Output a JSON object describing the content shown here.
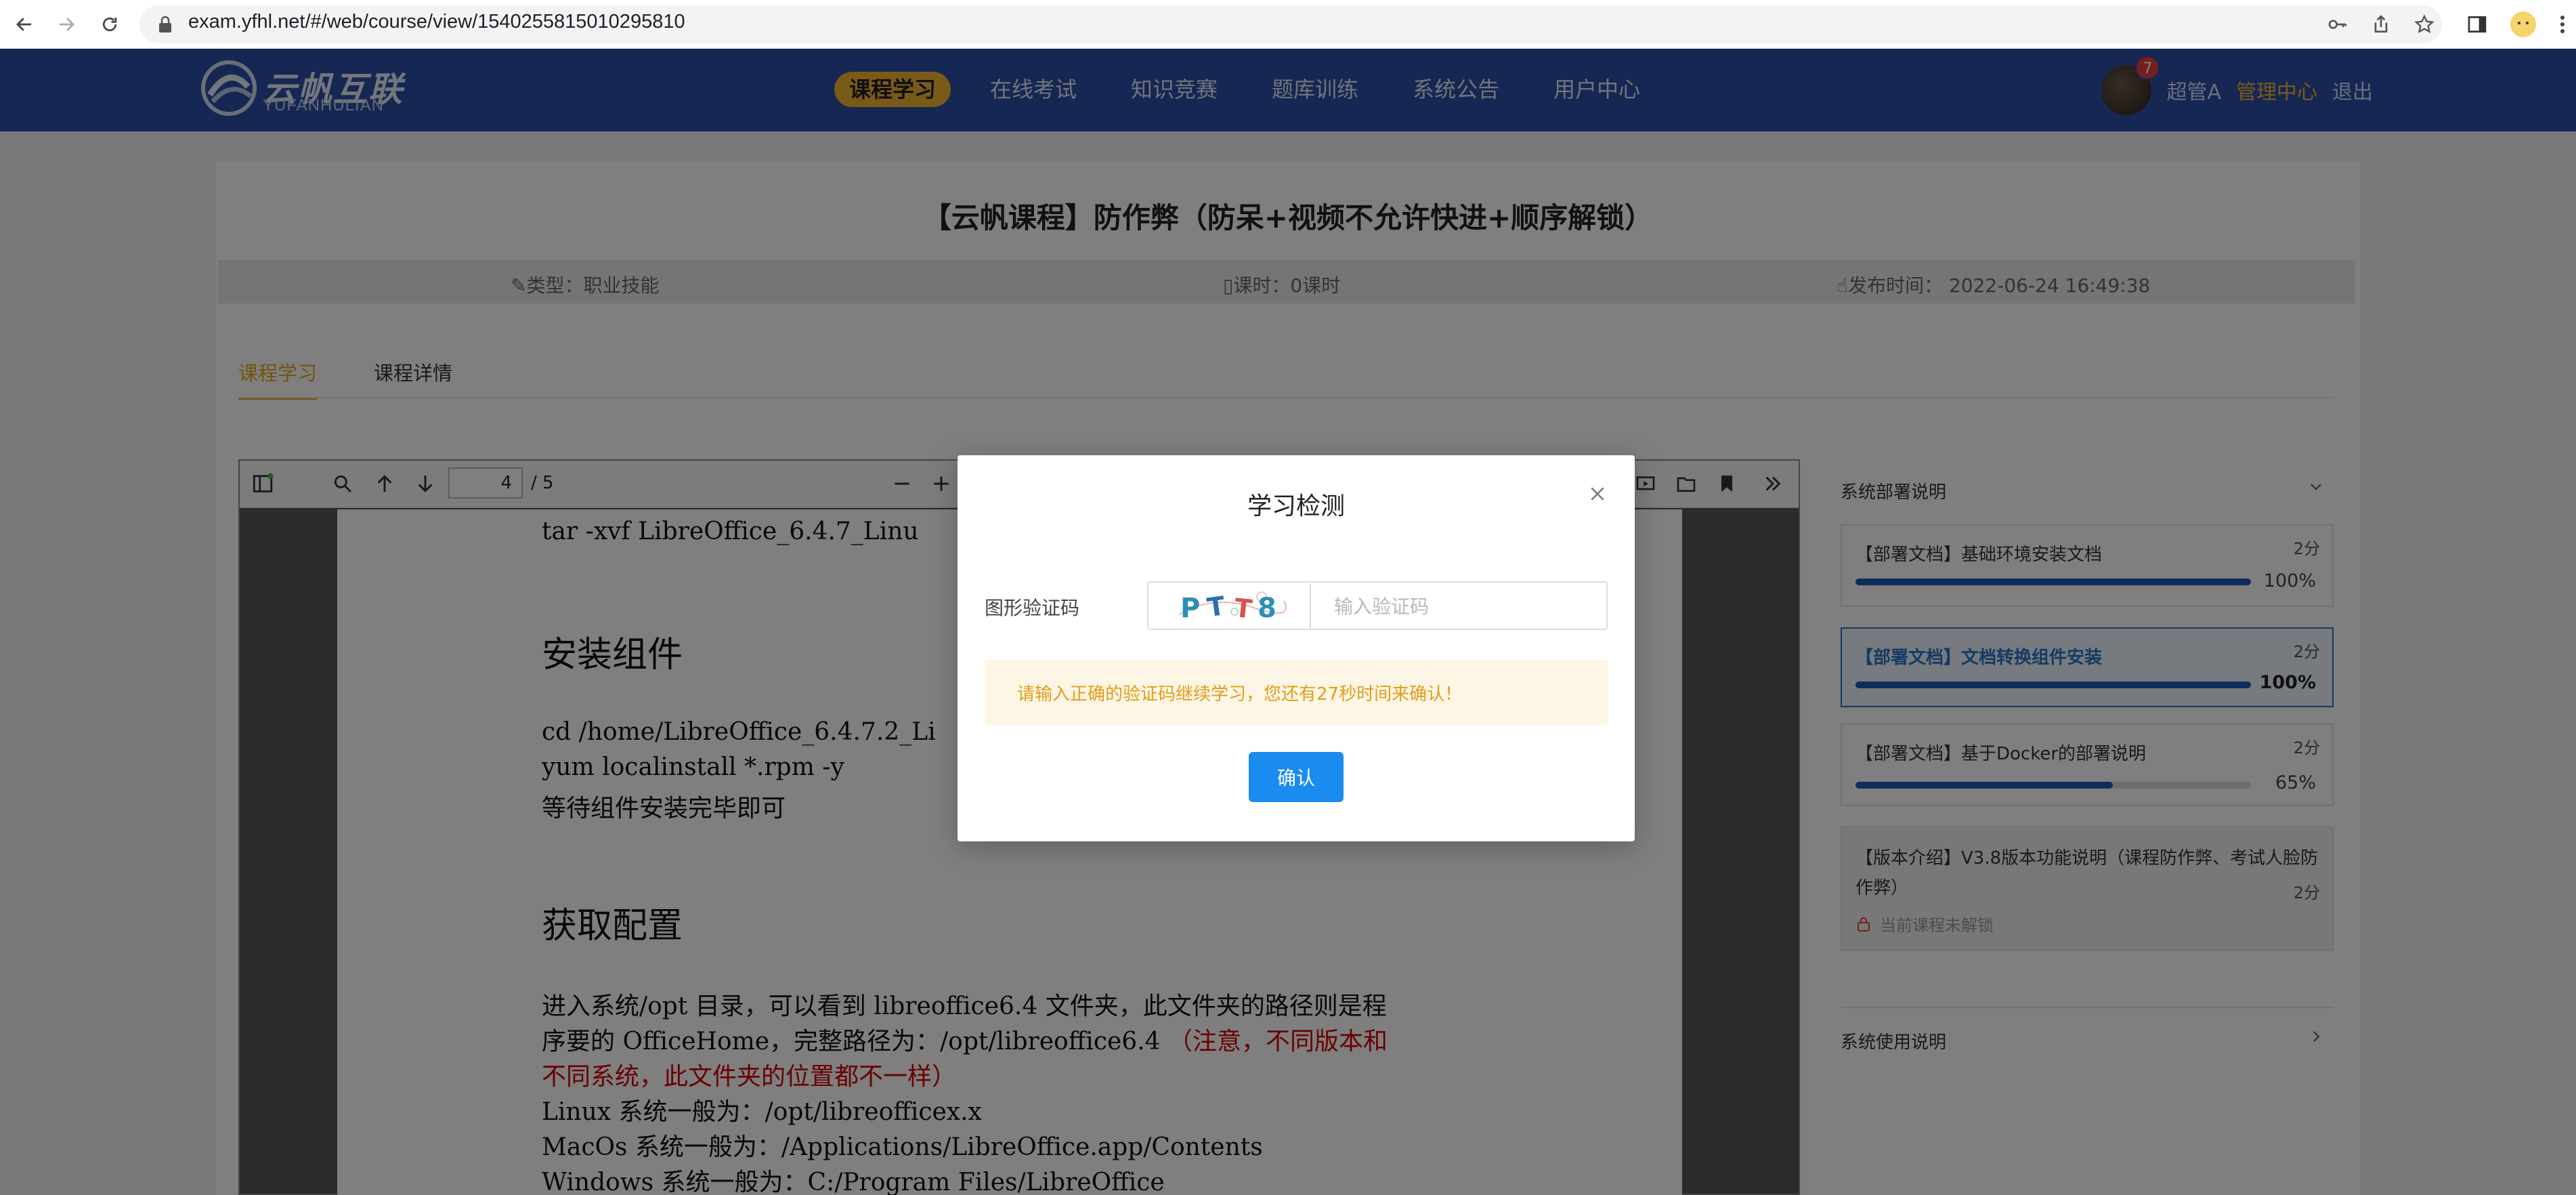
{
  "browser": {
    "url": "exam.yfhl.net/#/web/course/view/1540255815010295810"
  },
  "header": {
    "logo_cn": "云帆互联",
    "logo_en": "YUFANHULIAN",
    "nav": [
      {
        "label": "课程学习",
        "active": true
      },
      {
        "label": "在线考试"
      },
      {
        "label": "知识竞赛"
      },
      {
        "label": "题库训练"
      },
      {
        "label": "系统公告"
      },
      {
        "label": "用户中心"
      }
    ],
    "badge_count": "7",
    "user_name": "超管A",
    "admin_link": "管理中心",
    "logout_link": "退出"
  },
  "course": {
    "title": "【云帆课程】防作弊（防呆+视频不允许快进+顺序解锁）",
    "type": "类型：职业技能",
    "hours": "课时：0课时",
    "publish_time": "发布时间：  2022-06-24 16:49:38"
  },
  "tabs": [
    {
      "label": "课程学习",
      "active": true
    },
    {
      "label": "课程详情"
    }
  ],
  "viewer": {
    "page_current": "4",
    "page_total": "/ 5"
  },
  "pdf": {
    "line_tar": "tar -xvf LibreOffice_6.4.7_Linu",
    "h_install": "安装组件",
    "line_cd": "cd /home/LibreOffice_6.4.7.2_Li",
    "line_yum": "yum localinstall *.rpm -y",
    "line_wait": "等待组件安装完毕即可",
    "h_config": "获取配置",
    "p1": "进入系统/opt 目录，可以看到 libreoffice6.4 文件夹，此文件夹的路径则是程",
    "p2a": "序要的 OfficeHome，完整路径为：/opt/libreoffice6.4 ",
    "p2b": "（注意，不同版本和",
    "p3": "不同系统，此文件夹的位置都不一样）",
    "p4": "Linux 系统一般为：/opt/libreofficex.x",
    "p5": "MacOs 系统一般为：/Applications/LibreOffice.app/Contents",
    "p6": "Windows 系统一般为：C:/Program Files/LibreOffice"
  },
  "sidebar": {
    "section1": "系统部署说明",
    "lessons": [
      {
        "title": "【部署文档】基础环境安装文档",
        "time": "2分",
        "progress": 100,
        "progress_label": "100%"
      },
      {
        "title": "【部署文档】文档转换组件安装",
        "time": "2分",
        "progress": 100,
        "progress_label": "100%"
      },
      {
        "title": "【部署文档】基于Docker的部署说明",
        "time": "2分",
        "progress": 65,
        "progress_label": "65%"
      },
      {
        "title_line1": "【版本介绍】V3.8版本功能说明（课程防作弊、考试人脸防",
        "title_line2": "作弊）",
        "time": "2分",
        "lock_text": "当前课程未解锁"
      }
    ],
    "section2": "系统使用说明"
  },
  "modal": {
    "title": "学习检测",
    "captcha_label": "图形验证码",
    "captcha_text": "PTT8",
    "captcha_placeholder": "输入验证码",
    "warning": "请输入正确的验证码继续学习，您还有27秒时间来确认！",
    "confirm": "确认"
  },
  "colors": {
    "header_bg": "#2c4fa6",
    "nav_active": "#f2b531",
    "primary_button": "#1a8cf0",
    "warning_text": "#e29c1a",
    "progress": "#1f5ab8"
  }
}
